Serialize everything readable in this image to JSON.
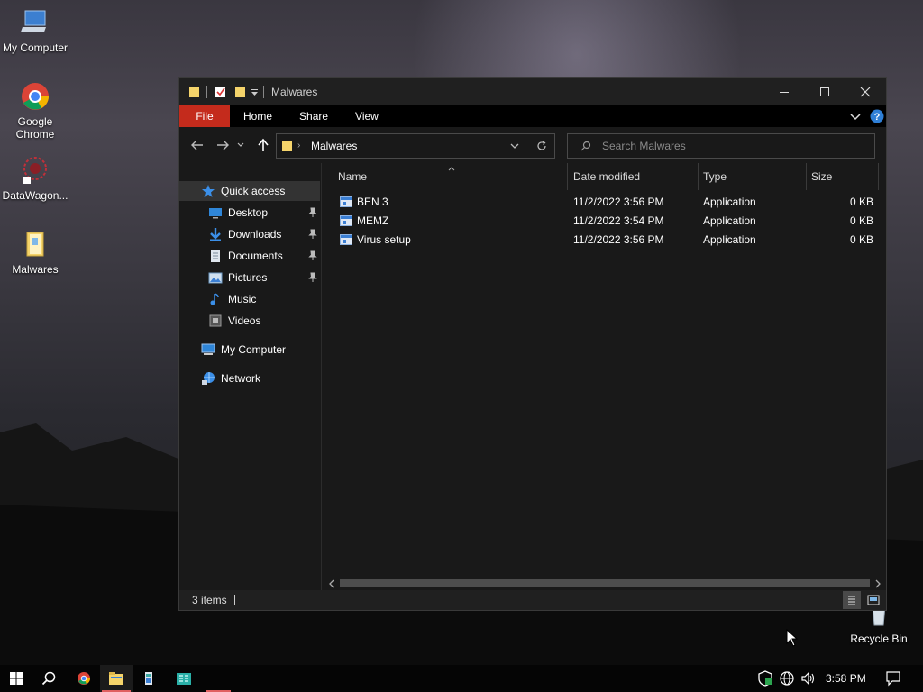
{
  "desktop": {
    "icons": [
      {
        "label": "My Computer"
      },
      {
        "label": "Google Chrome"
      },
      {
        "label": "DataWagon..."
      },
      {
        "label": "Malwares"
      },
      {
        "label": "Recycle Bin"
      }
    ]
  },
  "window": {
    "title": "Malwares",
    "ribbon_tabs": [
      "File",
      "Home",
      "Share",
      "View"
    ],
    "address": {
      "segment": "Malwares"
    },
    "search": {
      "placeholder": "Search Malwares"
    },
    "sidebar": {
      "items": [
        {
          "label": "Quick access",
          "icon": "star-icon"
        },
        {
          "label": "Desktop",
          "icon": "desktop-icon",
          "pinned": true
        },
        {
          "label": "Downloads",
          "icon": "download-icon",
          "pinned": true
        },
        {
          "label": "Documents",
          "icon": "document-icon",
          "pinned": true
        },
        {
          "label": "Pictures",
          "icon": "picture-icon",
          "pinned": true
        },
        {
          "label": "Music",
          "icon": "music-icon"
        },
        {
          "label": "Videos",
          "icon": "video-icon"
        },
        {
          "label": "My Computer",
          "icon": "computer-icon"
        },
        {
          "label": "Network",
          "icon": "network-icon"
        }
      ]
    },
    "columns": [
      "Name",
      "Date modified",
      "Type",
      "Size"
    ],
    "files": [
      {
        "name": "BEN 3",
        "date": "11/2/2022 3:56 PM",
        "type": "Application",
        "size": "0 KB"
      },
      {
        "name": "MEMZ",
        "date": "11/2/2022 3:54 PM",
        "type": "Application",
        "size": "0 KB"
      },
      {
        "name": "Virus setup",
        "date": "11/2/2022 3:56 PM",
        "type": "Application",
        "size": "0 KB"
      }
    ],
    "status": {
      "items_count": "3 items"
    }
  },
  "taskbar": {
    "clock": "3:58 PM"
  },
  "colors": {
    "file_tab": "#c42b1c",
    "accent": "#3b7fd4",
    "folder": "#f5d46b"
  }
}
